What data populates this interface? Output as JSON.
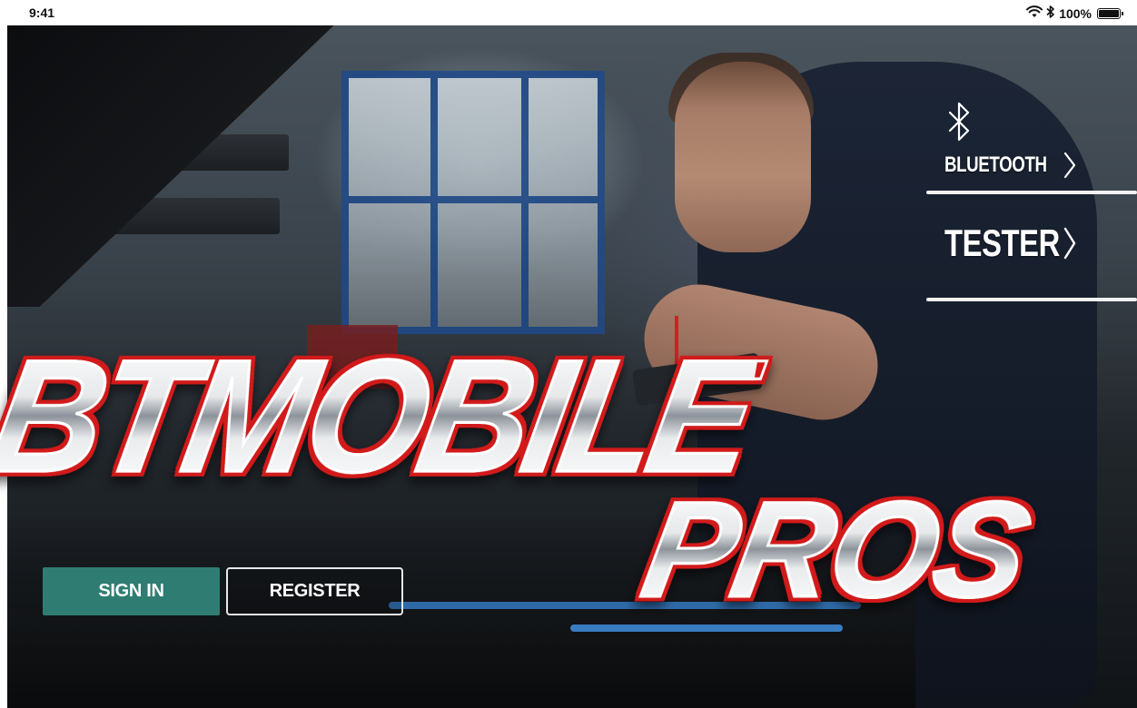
{
  "status_bar": {
    "time": "9:41",
    "battery_percent": "100%",
    "icons": [
      "wifi-icon",
      "bluetooth-icon",
      "battery-icon"
    ]
  },
  "logo": {
    "main": "BTMOBILE",
    "sub": "PROS"
  },
  "nav": {
    "bluetooth_label": "BLUETOOTH",
    "tester_label": "TESTER"
  },
  "actions": {
    "sign_in_label": "SIGN IN",
    "register_label": "REGISTER"
  },
  "colors": {
    "sign_in_bg": "#2f7d72",
    "logo_outline": "#d21a1a",
    "shop_window_frame": "#1e4a8a"
  }
}
